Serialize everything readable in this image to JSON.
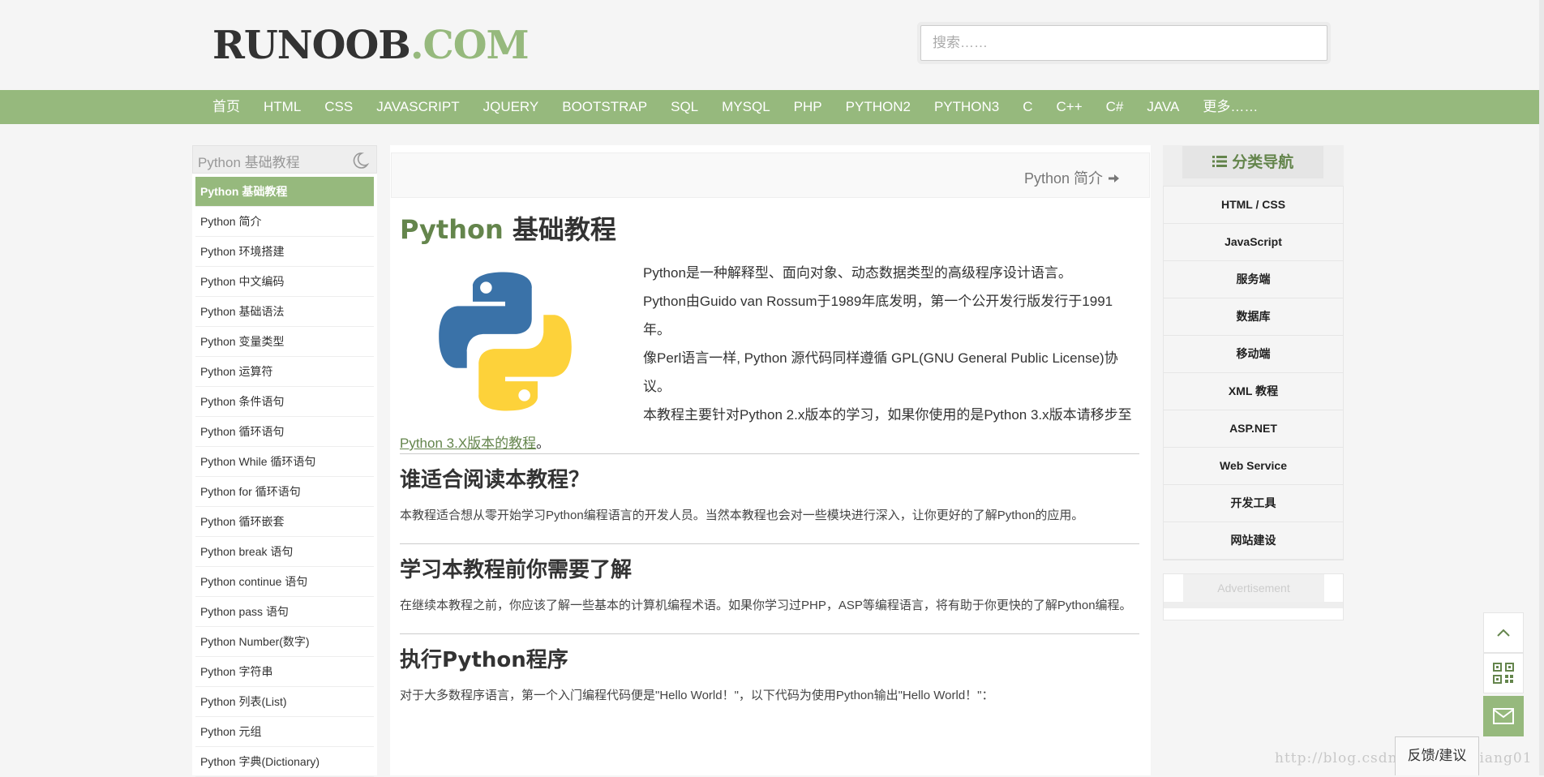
{
  "header": {
    "logo_part1": "RUNOOB",
    "logo_part2": ".COM",
    "search_placeholder": "搜索……"
  },
  "nav": {
    "items": [
      "首页",
      "HTML",
      "CSS",
      "JAVASCRIPT",
      "JQUERY",
      "BOOTSTRAP",
      "SQL",
      "MYSQL",
      "PHP",
      "PYTHON2",
      "PYTHON3",
      "C",
      "C++",
      "C#",
      "JAVA",
      "更多……"
    ]
  },
  "sidebar": {
    "title": "Python 基础教程",
    "items": [
      "Python 基础教程",
      "Python 简介",
      "Python 环境搭建",
      "Python 中文编码",
      "Python 基础语法",
      "Python 变量类型",
      "Python 运算符",
      "Python 条件语句",
      "Python 循环语句",
      "Python While 循环语句",
      "Python for 循环语句",
      "Python 循环嵌套",
      "Python break 语句",
      "Python continue 语句",
      "Python pass 语句",
      "Python Number(数字)",
      "Python 字符串",
      "Python 列表(List)",
      "Python 元组",
      "Python 字典(Dictionary)"
    ]
  },
  "main": {
    "next_link": "Python 简介",
    "title_green": "Python",
    "title_rest": " 基础教程",
    "intro_lines": [
      "Python是一种解释型、面向对象、动态数据类型的高级程序设计语言。",
      "Python由Guido van Rossum于1989年底发明，第一个公开发行版发行于1991年。",
      "像Perl语言一样, Python 源代码同样遵循 GPL(GNU General Public License)协议。"
    ],
    "intro_tail_before": "本教程主要针对Python 2.x版本的学习，如果你使用的是Python 3.x版本请移步至",
    "intro_tail_link": "Python 3.X版本的教程",
    "intro_tail_after": "。",
    "section1_title": "谁适合阅读本教程？",
    "section1_text": "本教程适合想从零开始学习Python编程语言的开发人员。当然本教程也会对一些模块进行深入，让你更好的了解Python的应用。",
    "section2_title": "学习本教程前你需要了解",
    "section2_text": "在继续本教程之前，你应该了解一些基本的计算机编程术语。如果你学习过PHP，ASP等编程语言，将有助于你更快的了解Python编程。",
    "section3_title": "执行Python程序",
    "section3_text": "对于大多数程序语言，第一个入门编程代码便是\"Hello World！\"，以下代码为使用Python输出\"Hello World！\"："
  },
  "right": {
    "category_title": "分类导航",
    "categories": [
      "HTML / CSS",
      "JavaScript",
      "服务端",
      "数据库",
      "移动端",
      "XML 教程",
      "ASP.NET",
      "Web Service",
      "开发工具",
      "网站建设"
    ],
    "advertisement": "Advertisement"
  },
  "floating": {
    "feedback": "反馈/建议"
  },
  "watermark": "http://blog.csdn.net/kuanxiang01",
  "colors": {
    "brand_green": "#96b97d",
    "title_green": "#64854c"
  }
}
